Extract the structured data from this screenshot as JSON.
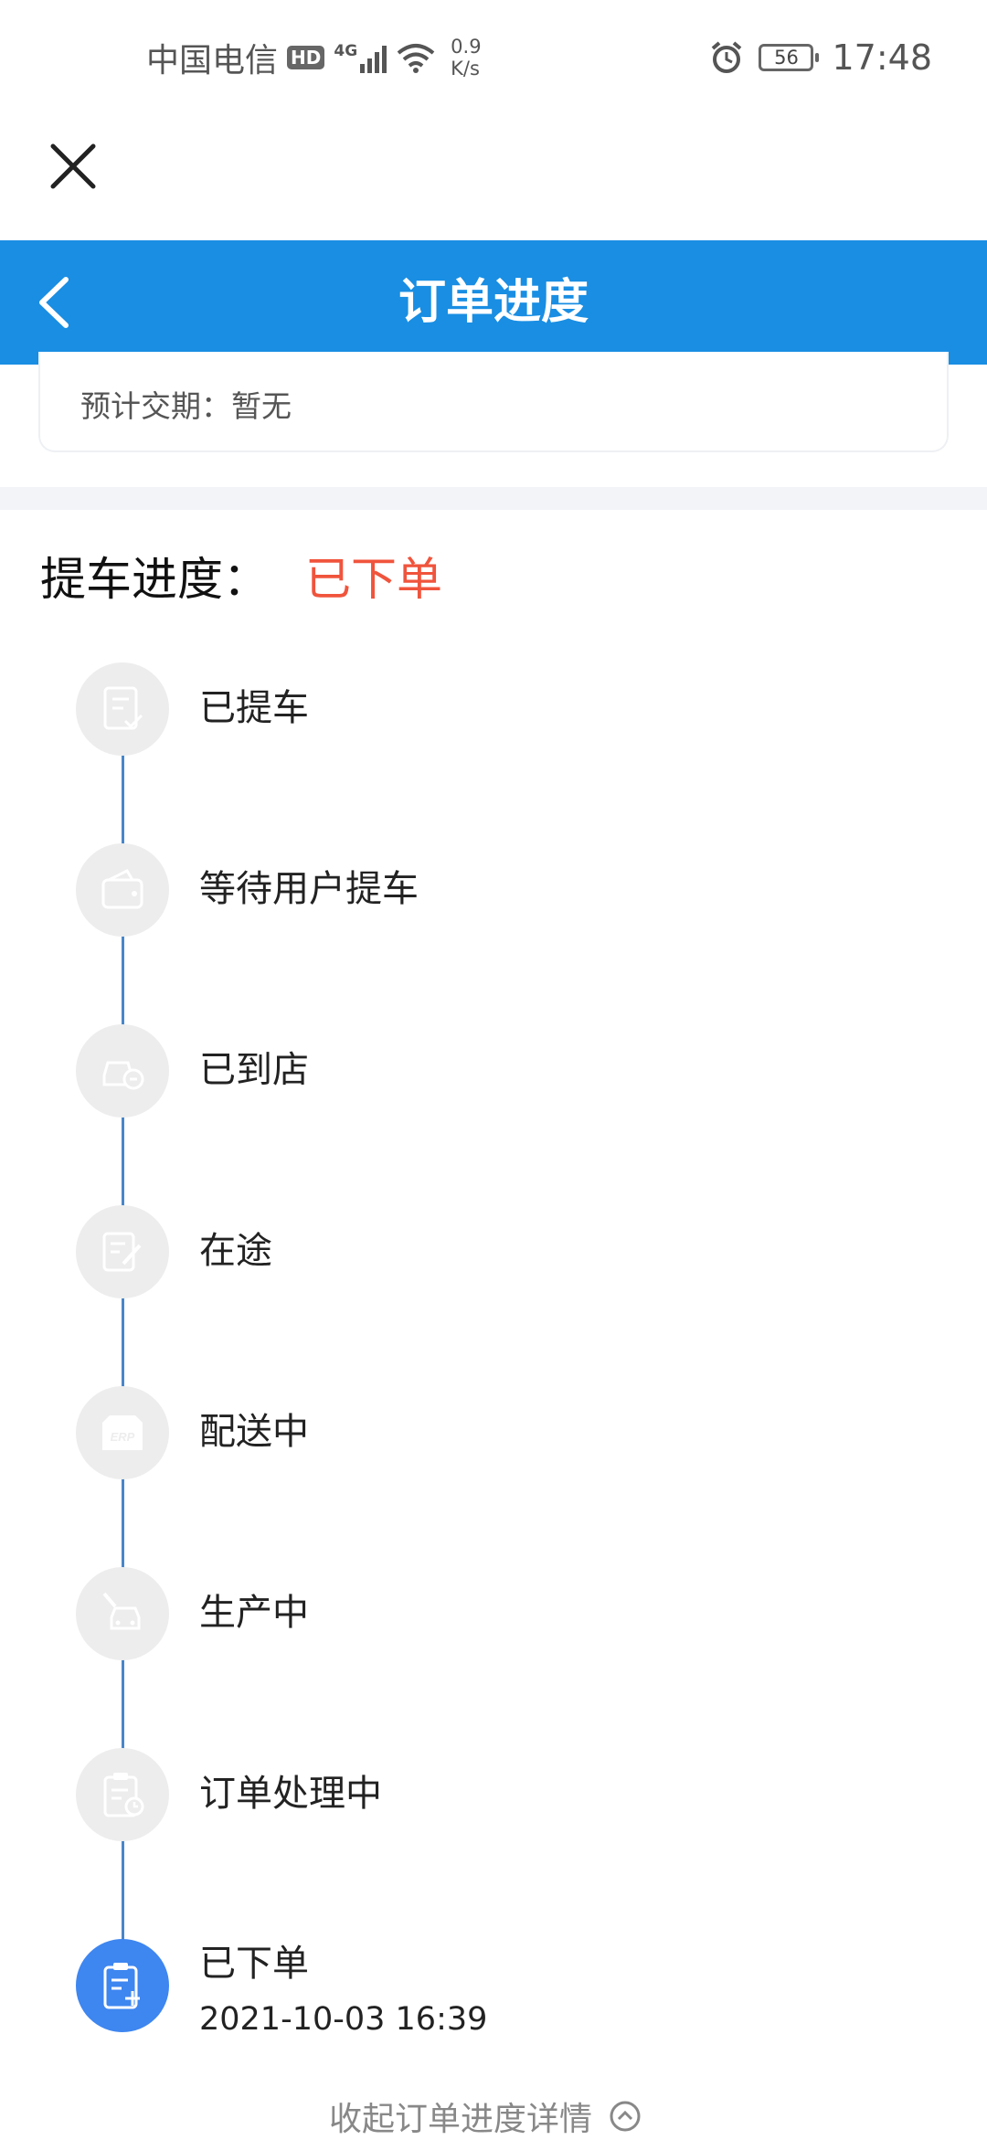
{
  "status_bar": {
    "carrier": "中国电信",
    "hd": "HD",
    "network": "4G",
    "speed_value": "0.9",
    "speed_unit": "K/s",
    "battery": "56",
    "time": "17:48"
  },
  "header": {
    "title": "订单进度"
  },
  "info": {
    "delivery": "预计交期：暂无"
  },
  "progress": {
    "label": "提车进度：",
    "status": "已下单"
  },
  "steps": [
    {
      "label": "已提车",
      "icon": "checklist-icon",
      "active": false
    },
    {
      "label": "等待用户提车",
      "icon": "wallet-icon",
      "active": false
    },
    {
      "label": "已到店",
      "icon": "car-store-icon",
      "active": false
    },
    {
      "label": "在途",
      "icon": "edit-note-icon",
      "active": false
    },
    {
      "label": "配送中",
      "icon": "erp-box-icon",
      "active": false
    },
    {
      "label": "生产中",
      "icon": "car-production-icon",
      "active": false
    },
    {
      "label": "订单处理中",
      "icon": "clipboard-clock-icon",
      "active": false
    },
    {
      "label": "已下单",
      "icon": "clipboard-add-icon",
      "active": true,
      "time": "2021-10-03 16:39"
    }
  ],
  "footer": {
    "collapse": "收起订单进度详情"
  },
  "colors": {
    "primary": "#198ee3",
    "status_red": "#f0543c",
    "active_step": "#3e86f0",
    "line": "#4a86c8"
  }
}
